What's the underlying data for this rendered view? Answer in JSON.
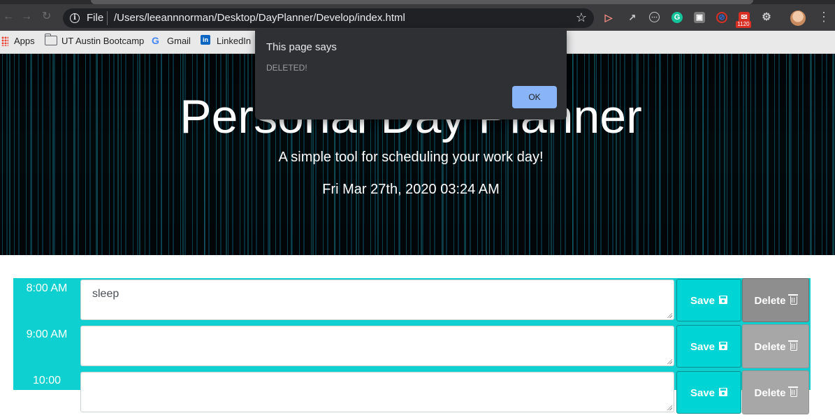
{
  "browser": {
    "scheme_label": "File",
    "url": "/Users/leeannnorman/Desktop/DayPlanner/Develop/index.html",
    "extension_badge": "1120"
  },
  "bookmarks": [
    {
      "label": "Apps"
    },
    {
      "label": "UT Austin Bootcamp"
    },
    {
      "label": "Gmail"
    },
    {
      "label": "LinkedIn"
    }
  ],
  "hero": {
    "title": "Personal Day Planner",
    "subtitle": "A simple tool for scheduling your work day!",
    "datetime": "Fri Mar 27th, 2020 03:24 AM"
  },
  "dialog": {
    "title": "This page says",
    "message": "DELETED!",
    "ok_label": "OK"
  },
  "planner": {
    "rows": [
      {
        "hour": "8:00 AM",
        "task": "sleep",
        "save_label": "Save",
        "delete_label": "Delete"
      },
      {
        "hour": "9:00 AM",
        "task": "",
        "save_label": "Save",
        "delete_label": "Delete"
      },
      {
        "hour": "10:00",
        "task": "",
        "save_label": "Save",
        "delete_label": "Delete"
      }
    ]
  },
  "colors": {
    "accent": "#0fd0d0",
    "save": "#00d4d4",
    "delete": "#8e8e8e",
    "dialog_button": "#8ab4f8"
  },
  "icons": {
    "save": "floppy-disk-icon",
    "delete": "trash-icon"
  }
}
